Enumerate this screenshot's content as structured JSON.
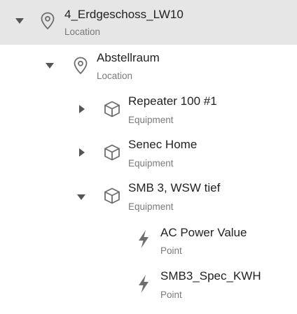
{
  "tree": {
    "nodes": [
      {
        "title": "4_Erdgeschoss_LW10",
        "subtitle": "Location",
        "icon": "location-pin-icon",
        "caret": "expanded",
        "selected": true
      },
      {
        "title": "Abstellraum",
        "subtitle": "Location",
        "icon": "location-pin-icon",
        "caret": "expanded"
      },
      {
        "title": "Repeater 100 #1",
        "subtitle": "Equipment",
        "icon": "cube-icon",
        "caret": "collapsed"
      },
      {
        "title": "Senec Home",
        "subtitle": "Equipment",
        "icon": "cube-icon",
        "caret": "collapsed"
      },
      {
        "title": "SMB 3, WSW tief",
        "subtitle": "Equipment",
        "icon": "cube-icon",
        "caret": "expanded"
      },
      {
        "title": "AC Power Value",
        "subtitle": "Point",
        "icon": "lightning-bolt-icon",
        "caret": "none"
      },
      {
        "title": "SMB3_Spec_KWH",
        "subtitle": "Point",
        "icon": "lightning-bolt-icon",
        "caret": "none"
      }
    ]
  },
  "colors": {
    "selected_background": "#e6e6e6",
    "icon": "#6e6e6e",
    "title_text": "#222222",
    "subtitle_text": "#7a7a7a"
  }
}
